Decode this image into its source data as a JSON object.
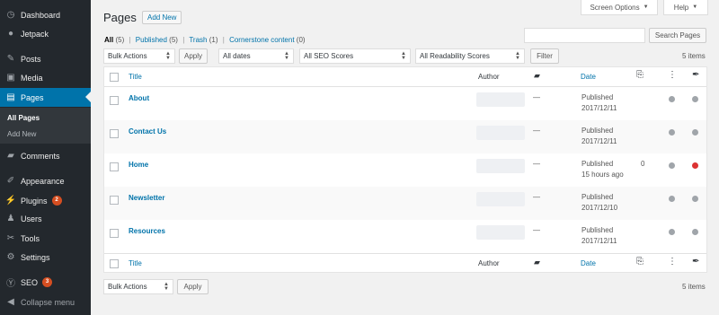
{
  "sidebar": {
    "items": [
      {
        "label": "Dashboard",
        "icon": "dashboard-icon",
        "glyph": "◷"
      },
      {
        "label": "Jetpack",
        "icon": "jetpack-icon",
        "glyph": "●"
      },
      {
        "label": "Posts",
        "icon": "pushpin-icon",
        "glyph": "✎"
      },
      {
        "label": "Media",
        "icon": "media-icon",
        "glyph": "▣"
      },
      {
        "label": "Pages",
        "icon": "pages-icon",
        "glyph": "▤"
      },
      {
        "label": "Comments",
        "icon": "comments-icon",
        "glyph": "▰"
      },
      {
        "label": "Appearance",
        "icon": "paintbrush-icon",
        "glyph": "✐"
      },
      {
        "label": "Plugins",
        "icon": "plugins-icon",
        "glyph": "⚡",
        "badge": "2"
      },
      {
        "label": "Users",
        "icon": "users-icon",
        "glyph": "♟"
      },
      {
        "label": "Tools",
        "icon": "tools-icon",
        "glyph": "✂"
      },
      {
        "label": "Settings",
        "icon": "settings-icon",
        "glyph": "⚙"
      },
      {
        "label": "SEO",
        "icon": "yoast-icon",
        "glyph": "Ⓨ",
        "badge": "3"
      },
      {
        "label": "Collapse menu",
        "icon": "collapse-icon",
        "glyph": "◀"
      }
    ],
    "submenu": [
      "All Pages",
      "Add New"
    ]
  },
  "top": {
    "screen_options": "Screen Options",
    "help": "Help"
  },
  "page_title": "Pages",
  "add_new": "Add New",
  "filters": {
    "all": "All",
    "all_count": "(5)",
    "published": "Published",
    "published_count": "(5)",
    "trash": "Trash",
    "trash_count": "(1)",
    "cornerstone": "Cornerstone content",
    "cornerstone_count": "(0)",
    "sep": "|"
  },
  "search_button": "Search Pages",
  "toolbar": {
    "bulk_actions": "Bulk Actions",
    "apply": "Apply",
    "dates": "All dates",
    "seo": "All SEO Scores",
    "readability": "All Readability Scores",
    "filter": "Filter",
    "items": "5 items"
  },
  "table": {
    "headers": {
      "title": "Title",
      "author": "Author",
      "date": "Date"
    },
    "rows": [
      {
        "title": "About",
        "comments": "—",
        "status": "Published",
        "date": "2017/12/11",
        "links": "",
        "seo": "#a0a5aa",
        "read": "#a0a5aa"
      },
      {
        "title": "Contact Us",
        "comments": "—",
        "status": "Published",
        "date": "2017/12/11",
        "links": "",
        "seo": "#a0a5aa",
        "read": "#a0a5aa"
      },
      {
        "title": "Home",
        "comments": "—",
        "status": "Published",
        "date": "15 hours ago",
        "links": "0",
        "seo": "#a0a5aa",
        "read": "#dc3232"
      },
      {
        "title": "Newsletter",
        "comments": "—",
        "status": "Published",
        "date": "2017/12/10",
        "links": "",
        "seo": "#a0a5aa",
        "read": "#a0a5aa"
      },
      {
        "title": "Resources",
        "comments": "—",
        "status": "Published",
        "date": "2017/12/11",
        "links": "",
        "seo": "#a0a5aa",
        "read": "#a0a5aa"
      }
    ]
  },
  "bottom_toolbar": {
    "bulk_actions": "Bulk Actions",
    "apply": "Apply",
    "items": "5 items"
  }
}
